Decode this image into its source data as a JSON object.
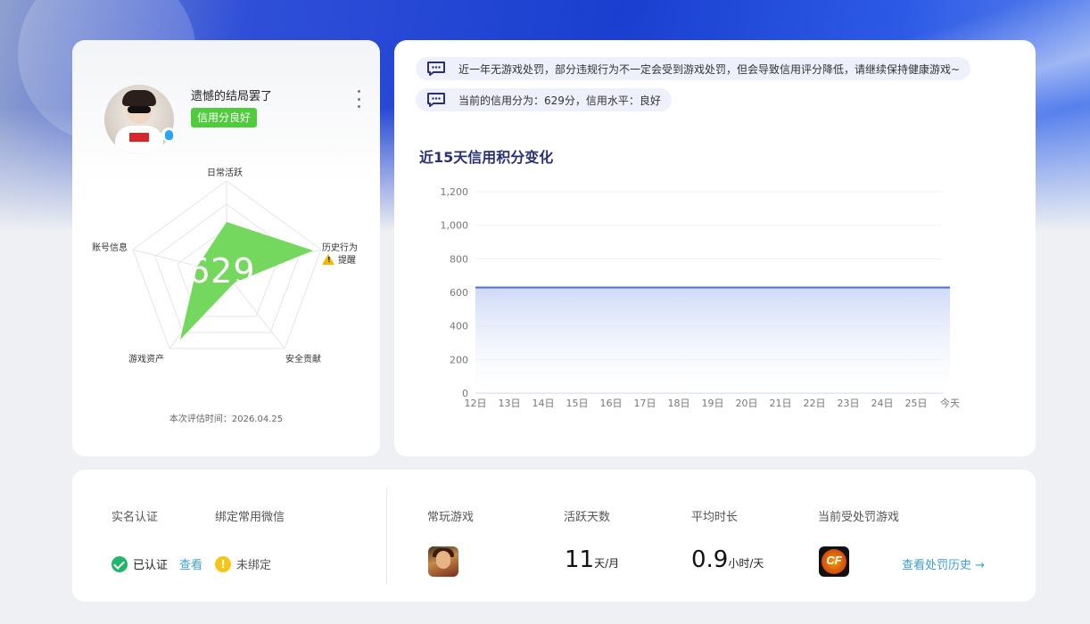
{
  "profile": {
    "username": "遗憾的结局罢了",
    "credit_badge": "信用分良好",
    "score": "629",
    "radar_labels": {
      "daily": "日常活跃",
      "history": "历史行为",
      "security": "安全贡献",
      "assets": "游戏资产",
      "account": "账号信息"
    },
    "warning_label": "提醒",
    "eval_time": "本次评估时间：2026.04.25",
    "colors": {
      "radar_fill": "#6ed655",
      "badge": "#4fcb3d"
    }
  },
  "notices": [
    {
      "icon": "message-icon",
      "text": "近一年无游戏处罚，部分违规行为不一定会受到游戏处罚，但会导致信用评分降低，请继续保持健康游戏~"
    },
    {
      "icon": "message-icon",
      "text": "当前的信用分为：629分，信用水平：良好"
    }
  ],
  "chart_data": {
    "type": "area",
    "title": "近15天信用积分变化",
    "categories": [
      "12日",
      "13日",
      "14日",
      "15日",
      "16日",
      "17日",
      "18日",
      "19日",
      "20日",
      "21日",
      "22日",
      "23日",
      "24日",
      "25日",
      "今天"
    ],
    "values": [
      629,
      629,
      629,
      629,
      629,
      629,
      629,
      629,
      629,
      629,
      629,
      629,
      629,
      629,
      629
    ],
    "yticks": [
      "0",
      "200",
      "400",
      "600",
      "800",
      "1,000",
      "1,200"
    ],
    "ylim": [
      0,
      1200
    ],
    "color": "#4a6fd8"
  },
  "bottom": {
    "realname_label": "实名认证",
    "realname_status": "已认证",
    "realname_link": "查看",
    "wechat_label": "绑定常用微信",
    "wechat_status": "未绑定",
    "fav_game_label": "常玩游戏",
    "active_days_label": "活跃天数",
    "active_days_value": "11",
    "active_days_unit": "天/月",
    "avg_time_label": "平均时长",
    "avg_time_value": "0.9",
    "avg_time_unit": "小时/天",
    "penalty_game_label": "当前受处罚游戏",
    "penalty_history_link": "查看处罚历史 →"
  }
}
